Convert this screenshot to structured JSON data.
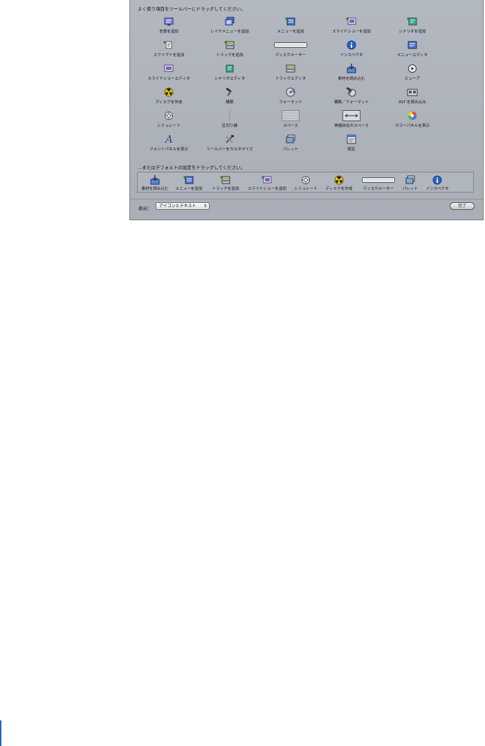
{
  "sheet": {
    "instruction": "よく使う項目をツールバーにドラッグしてください。",
    "palette": [
      {
        "label": "言語を追加",
        "icon": "language-icon"
      },
      {
        "label": "レイヤメニューを追加",
        "icon": "layered-menu-icon"
      },
      {
        "label": "メニューを追加",
        "icon": "add-menu-icon"
      },
      {
        "label": "スライドショーを追加",
        "icon": "slideshow-icon"
      },
      {
        "label": "シナリオを追加",
        "icon": "story-icon"
      },
      {
        "label": "スクリプトを追加",
        "icon": "script-icon"
      },
      {
        "label": "トラックを追加",
        "icon": "track-icon"
      },
      {
        "label": "ディスクメーター",
        "icon": "disc-meter-icon"
      },
      {
        "label": "インスペクタ",
        "icon": "inspector-icon"
      },
      {
        "label": "メニューエディタ",
        "icon": "menu-editor-icon"
      },
      {
        "label": "スライドショーエディタ",
        "icon": "slideshow-editor-icon"
      },
      {
        "label": "シナリオエディタ",
        "icon": "story-editor-icon"
      },
      {
        "label": "トラックエディタ",
        "icon": "track-editor-icon"
      },
      {
        "label": "素材を読み込む",
        "icon": "import-asset-icon"
      },
      {
        "label": "ビューア",
        "icon": "viewer-icon"
      },
      {
        "label": "ディスクを作成",
        "icon": "burn-icon"
      },
      {
        "label": "構築",
        "icon": "build-hammer-icon"
      },
      {
        "label": "フォーマット",
        "icon": "format-icon"
      },
      {
        "label": "構築／フォーマット",
        "icon": "build-format-icon"
      },
      {
        "label": "DLT を読み込み",
        "icon": "dlt-icon"
      },
      {
        "label": "シミュレート",
        "icon": "simulate-icon"
      },
      {
        "label": "区切り線",
        "icon": "separator-icon"
      },
      {
        "label": "スペース",
        "icon": "space-icon"
      },
      {
        "label": "伸縮自在のスペース",
        "icon": "flexible-space-icon"
      },
      {
        "label": "カラーパネルを表示",
        "icon": "color-wheel-icon"
      },
      {
        "label": "フォントパネルを表示",
        "icon": "font-icon"
      },
      {
        "label": "ツールバーをカスタマイズ",
        "icon": "customize-tools-icon"
      },
      {
        "label": "パレット",
        "icon": "palette-icon"
      },
      {
        "label": "設定",
        "icon": "settings-icon"
      }
    ],
    "defaults_instruction": "...またはデフォルトの設定をドラッグしてください。",
    "default_set": [
      {
        "label": "素材を読み込む",
        "icon": "import-asset-icon"
      },
      {
        "label": "メニューを追加",
        "icon": "add-menu-icon"
      },
      {
        "label": "トラックを追加",
        "icon": "track-icon"
      },
      {
        "label": "スライドショーを追加",
        "icon": "slideshow-icon"
      },
      {
        "label": "シミュレート",
        "icon": "simulate-icon"
      },
      {
        "label": "ディスクを作成",
        "icon": "burn-icon"
      },
      {
        "label": "ディスクメーター",
        "icon": "disc-meter-icon"
      },
      {
        "label": "パレット",
        "icon": "palette-icon"
      },
      {
        "label": "インスペクタ",
        "icon": "inspector-icon"
      }
    ],
    "show_label": "表示：",
    "show_value": "アイコンとテキスト",
    "done_label": "完了"
  }
}
